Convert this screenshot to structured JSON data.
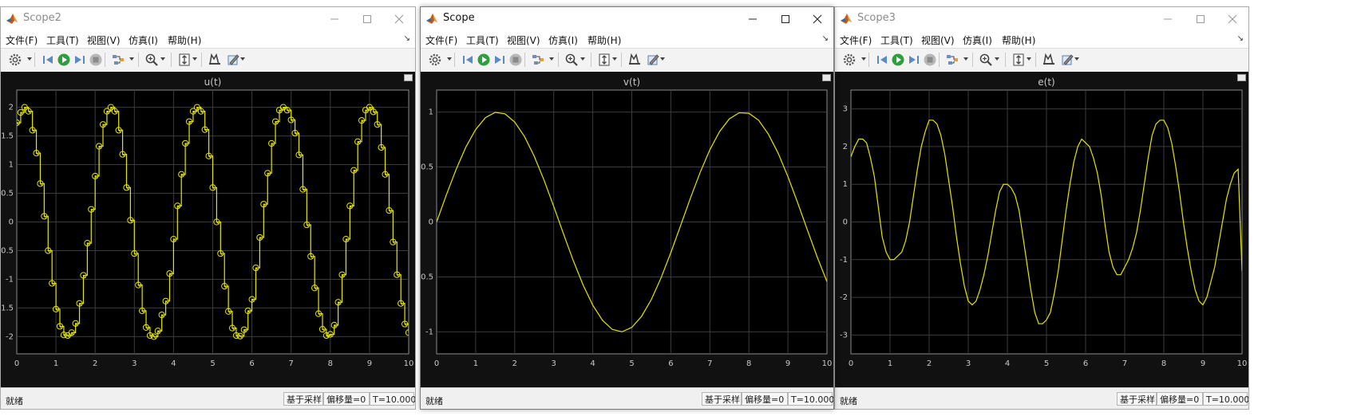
{
  "menus": [
    "文件(F)",
    "工具(T)",
    "视图(V)",
    "仿真(I)",
    "帮助(H)"
  ],
  "status": {
    "ready": "就绪",
    "mode": "基于采样",
    "offset": "偏移量=0",
    "time": "T=10.000"
  },
  "colors": {
    "trace": "#e6e600",
    "plot_bg": "#000000",
    "frame_bg": "#111111",
    "grid": "#3c3c3c",
    "tick_text": "#c8c8c8"
  },
  "toolbar_icons": [
    "gear-icon",
    "step-back-icon",
    "run-icon",
    "step-forward-icon",
    "stop-icon",
    "highlight-icon",
    "zoom-icon",
    "autoscale-icon",
    "cursor-measure-icon",
    "style-icon"
  ],
  "windows": [
    {
      "title": "Scope2",
      "active": false,
      "chart_data": {
        "type": "line",
        "title": "u(t)",
        "signal": "sampled",
        "marker": "circle",
        "xlim": [
          0,
          10
        ],
        "ylim": [
          -2.3,
          2.3
        ],
        "xticks": [
          "0",
          "1",
          "2",
          "3",
          "4",
          "5",
          "6",
          "7",
          "8",
          "9",
          "10"
        ],
        "yticks": [
          "-2",
          "-1.5",
          "-1",
          "-0.5",
          "0",
          "0.5",
          "1",
          "1.5",
          "2"
        ],
        "x": [
          0,
          0.1,
          0.2,
          0.3,
          0.4,
          0.5,
          0.6,
          0.7,
          0.8,
          0.9,
          1,
          1.1,
          1.2,
          1.3,
          1.4,
          1.5,
          1.6,
          1.7,
          1.8,
          1.9,
          2,
          2.1,
          2.2,
          2.3,
          2.4,
          2.5,
          2.6,
          2.7,
          2.8,
          2.9,
          3,
          3.1,
          3.2,
          3.3,
          3.4,
          3.5,
          3.6,
          3.7,
          3.8,
          3.9,
          4,
          4.1,
          4.2,
          4.3,
          4.4,
          4.5,
          4.6,
          4.7,
          4.8,
          4.9,
          5,
          5.1,
          5.2,
          5.3,
          5.4,
          5.5,
          5.6,
          5.7,
          5.8,
          5.9,
          6,
          6.1,
          6.2,
          6.3,
          6.4,
          6.5,
          6.6,
          6.7,
          6.8,
          6.9,
          7,
          7.1,
          7.2,
          7.3,
          7.4,
          7.5,
          7.6,
          7.7,
          7.8,
          7.9,
          8,
          8.1,
          8.2,
          8.3,
          8.4,
          8.5,
          8.6,
          8.7,
          8.8,
          8.9,
          9,
          9.1,
          9.2,
          9.3,
          9.4,
          9.5,
          9.6,
          9.7,
          9.8,
          9.9,
          10
        ],
        "y": [
          1.73,
          1.91,
          2,
          1.93,
          1.6,
          1.2,
          0.67,
          0.1,
          -0.5,
          -1.07,
          -1.52,
          -1.82,
          -1.97,
          -1.98,
          -1.93,
          -1.77,
          -1.42,
          -0.93,
          -0.37,
          0.22,
          0.8,
          1.32,
          1.7,
          1.93,
          2,
          1.93,
          1.6,
          1.18,
          0.6,
          0.03,
          -0.55,
          -1.1,
          -1.55,
          -1.84,
          -1.98,
          -2.0,
          -1.9,
          -1.62,
          -1.38,
          -0.9,
          -0.3,
          0.28,
          0.83,
          1.37,
          1.75,
          1.93,
          2,
          1.93,
          1.61,
          1.15,
          0.6,
          0.0,
          -0.55,
          -1.12,
          -1.56,
          -1.85,
          -1.98,
          -1.99,
          -1.88,
          -1.55,
          -1.35,
          -0.8,
          -0.27,
          0.31,
          0.85,
          1.37,
          1.75,
          1.95,
          2,
          1.95,
          1.78,
          1.55,
          1.17,
          0.57,
          -0.05,
          -0.6,
          -1.15,
          -1.6,
          -1.87,
          -1.98,
          -1.96,
          -1.8,
          -1.4,
          -0.92,
          -0.3,
          0.28,
          0.9,
          1.4,
          1.77,
          1.95,
          2,
          1.92,
          1.7,
          1.3,
          0.83,
          0.2,
          -0.35,
          -0.92,
          -1.42,
          -1.78,
          -1.93
        ]
      }
    },
    {
      "title": "Scope",
      "active": true,
      "chart_data": {
        "type": "line",
        "title": "v(t)",
        "function": "sin(t)",
        "xlim": [
          0,
          10
        ],
        "ylim": [
          -1.2,
          1.2
        ],
        "xticks": [
          "0",
          "1",
          "2",
          "3",
          "4",
          "5",
          "6",
          "7",
          "8",
          "9",
          "10"
        ],
        "yticks": [
          "-1",
          "-0.5",
          "0",
          "0.5",
          "1"
        ],
        "x": [
          0,
          0.25,
          0.5,
          0.75,
          1,
          1.25,
          1.5,
          1.75,
          2,
          2.25,
          2.5,
          2.75,
          3,
          3.25,
          3.5,
          3.75,
          4,
          4.25,
          4.5,
          4.75,
          5,
          5.25,
          5.5,
          5.75,
          6,
          6.25,
          6.5,
          6.75,
          7,
          7.25,
          7.5,
          7.75,
          8,
          8.25,
          8.5,
          8.75,
          9,
          9.25,
          9.5,
          9.75,
          10
        ],
        "y": [
          0,
          0.247,
          0.479,
          0.682,
          0.841,
          0.949,
          0.997,
          0.984,
          0.909,
          0.778,
          0.598,
          0.382,
          0.141,
          -0.108,
          -0.351,
          -0.572,
          -0.757,
          -0.895,
          -0.978,
          -0.999,
          -0.959,
          -0.859,
          -0.706,
          -0.508,
          -0.279,
          -0.033,
          0.215,
          0.45,
          0.657,
          0.823,
          0.938,
          0.993,
          0.989,
          0.925,
          0.798,
          0.625,
          0.412,
          0.174,
          -0.075,
          -0.319,
          -0.544
        ]
      }
    },
    {
      "title": "Scope3",
      "active": false,
      "chart_data": {
        "type": "line",
        "title": "e(t)",
        "xlim": [
          0,
          10
        ],
        "ylim": [
          -3.5,
          3.5
        ],
        "xticks": [
          "0",
          "1",
          "2",
          "3",
          "4",
          "5",
          "6",
          "7",
          "8",
          "9",
          "10"
        ],
        "yticks": [
          "-3",
          "-2",
          "-1",
          "0",
          "1",
          "2",
          "3"
        ],
        "x": [
          0,
          0.1,
          0.2,
          0.3,
          0.4,
          0.5,
          0.6,
          0.7,
          0.8,
          0.9,
          1,
          1.1,
          1.2,
          1.3,
          1.4,
          1.5,
          1.6,
          1.7,
          1.8,
          1.9,
          2,
          2.1,
          2.2,
          2.3,
          2.4,
          2.5,
          2.6,
          2.7,
          2.8,
          2.9,
          3,
          3.1,
          3.2,
          3.3,
          3.4,
          3.5,
          3.6,
          3.7,
          3.8,
          3.9,
          4,
          4.1,
          4.2,
          4.3,
          4.4,
          4.5,
          4.6,
          4.7,
          4.8,
          4.9,
          5,
          5.1,
          5.2,
          5.3,
          5.4,
          5.5,
          5.6,
          5.7,
          5.8,
          5.9,
          6,
          6.1,
          6.2,
          6.3,
          6.4,
          6.5,
          6.6,
          6.7,
          6.8,
          6.9,
          7,
          7.1,
          7.2,
          7.3,
          7.4,
          7.5,
          7.6,
          7.7,
          7.8,
          7.9,
          8,
          8.1,
          8.2,
          8.3,
          8.4,
          8.5,
          8.6,
          8.7,
          8.8,
          8.9,
          9,
          9.1,
          9.2,
          9.3,
          9.4,
          9.5,
          9.6,
          9.7,
          9.8,
          9.9,
          10
        ],
        "y": [
          1.73,
          2.0,
          2.2,
          2.2,
          2.1,
          1.7,
          1.2,
          0.4,
          -0.4,
          -0.8,
          -1.0,
          -1.0,
          -0.9,
          -0.8,
          -0.5,
          0.0,
          0.7,
          1.4,
          2.0,
          2.4,
          2.7,
          2.7,
          2.6,
          2.3,
          1.8,
          1.1,
          0.4,
          -0.4,
          -1.1,
          -1.7,
          -2.1,
          -2.2,
          -2.1,
          -1.8,
          -1.4,
          -0.9,
          -0.3,
          0.3,
          0.8,
          1.0,
          1.0,
          0.9,
          0.7,
          0.3,
          -0.4,
          -1.1,
          -1.8,
          -2.4,
          -2.7,
          -2.7,
          -2.6,
          -2.4,
          -1.9,
          -1.3,
          -0.5,
          0.3,
          1.0,
          1.6,
          2.0,
          2.2,
          2.1,
          2.0,
          1.7,
          1.3,
          0.7,
          -0.1,
          -0.8,
          -1.2,
          -1.4,
          -1.4,
          -1.2,
          -1.0,
          -0.7,
          -0.3,
          0.3,
          1.0,
          1.7,
          2.3,
          2.6,
          2.7,
          2.7,
          2.5,
          2.1,
          1.5,
          0.8,
          0.0,
          -0.7,
          -1.3,
          -1.8,
          -2.1,
          -2.2,
          -2.0,
          -1.6,
          -1.2,
          -0.6,
          0.0,
          0.6,
          1.0,
          1.3,
          1.4,
          -1.3
        ]
      }
    }
  ]
}
